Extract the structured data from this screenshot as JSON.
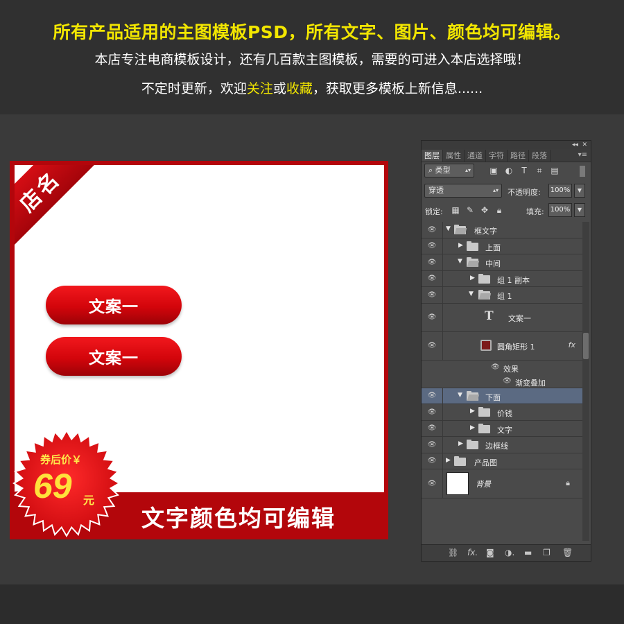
{
  "banner": {
    "line1": "所有产品适用的主图模板PSD，所有文字、图片、颜色均可编辑。",
    "line2": "本店专注电商模板设计，还有几百款主图模板，需要的可进入本店选择哦！",
    "line3_a": "不定时更新，欢迎",
    "line3_follow": "关注",
    "line3_or": "或",
    "line3_fav": "收藏",
    "line3_b": "，获取更多模板上新信息......"
  },
  "template": {
    "shop_name": "店名",
    "button1": "文案一",
    "button2": "文案一",
    "price_label": "券后价￥",
    "price_value": "69",
    "price_unit": "元",
    "bottom_text": "文字颜色均可编辑"
  },
  "panel": {
    "tabs": [
      "图层",
      "属性",
      "通道",
      "字符",
      "路径",
      "段落"
    ],
    "filter_label": "类型",
    "blend_mode": "穿透",
    "opacity_label": "不透明度:",
    "opacity_value": "100%",
    "lock_label": "锁定:",
    "fill_label": "填充:",
    "fill_value": "100%",
    "layers": {
      "l1": "框文字",
      "l2": "上面",
      "l3": "中间",
      "l4": "组 1 副本",
      "l5": "组 1",
      "l6": "文案一",
      "l7": "圆角矩形 1",
      "l7_fx": "fx",
      "effects": "效果",
      "gradient": "渐变叠加",
      "l8": "下面",
      "l9": "价钱",
      "l10": "文字",
      "l11": "边框线",
      "l12": "产品图",
      "l13": "背景"
    }
  },
  "colors": {
    "banner_yellow": "#f2e600",
    "template_red": "#b3060b",
    "price_yellow": "#ffe23b",
    "panel_bg": "#4a4a4a",
    "selected_row": "#5b6a82"
  }
}
